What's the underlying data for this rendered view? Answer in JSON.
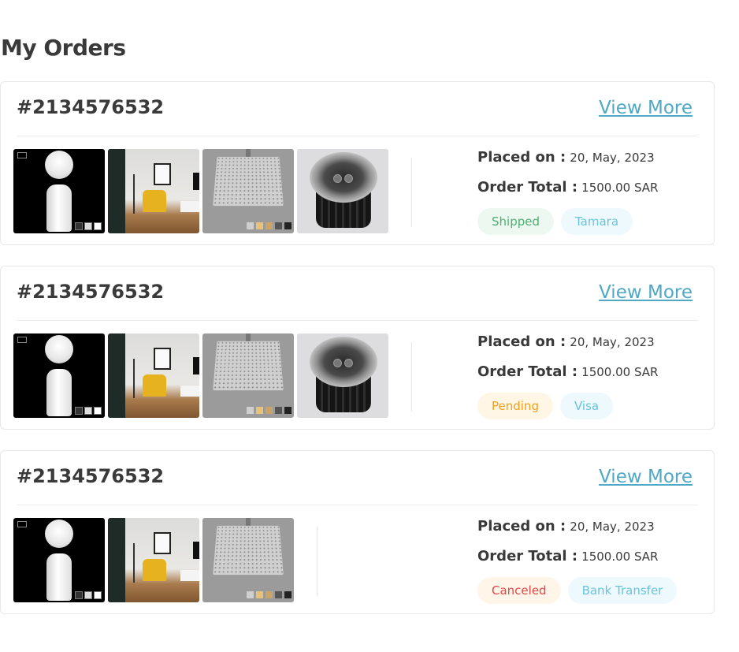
{
  "page": {
    "title": "My Orders"
  },
  "labels": {
    "placed_on": "Placed on :",
    "order_total": "Order Total :",
    "view_more": "View More"
  },
  "icons": {
    "thumbnails": [
      "basin-pedestal-image",
      "living-room-image",
      "shower-head-image",
      "ground-light-image"
    ]
  },
  "colors": {
    "link": "#4fa8c4",
    "shipped": {
      "text": "#4caf72",
      "bg": "#edf8f1"
    },
    "pending": {
      "text": "#f0a020",
      "bg": "#fff6e6"
    },
    "canceled": {
      "text": "#e04848",
      "bg": "#fff5e8"
    },
    "payment": {
      "text": "#6cc3dc",
      "bg": "#edf9fd"
    }
  },
  "orders": [
    {
      "id": "#2134576532",
      "placed_on": "20, May, 2023",
      "total": "1500.00 SAR",
      "status": "Shipped",
      "payment": "Tamara",
      "products": [
        "basin",
        "room",
        "shower",
        "light"
      ]
    },
    {
      "id": "#2134576532",
      "placed_on": "20, May, 2023",
      "total": "1500.00 SAR",
      "status": "Pending",
      "payment": "Visa",
      "products": [
        "basin",
        "room",
        "shower",
        "light"
      ]
    },
    {
      "id": "#2134576532",
      "placed_on": "20, May, 2023",
      "total": "1500.00 SAR",
      "status": "Canceled",
      "payment": "Bank Transfer",
      "products": [
        "basin",
        "room",
        "shower"
      ]
    }
  ]
}
